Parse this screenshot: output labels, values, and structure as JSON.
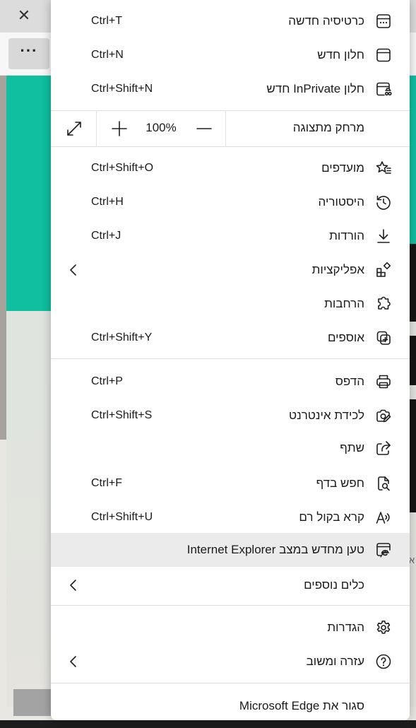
{
  "browser": {
    "close_glyph": "✕",
    "more_glyph": "···"
  },
  "background_page": {
    "accent_color": "#0fbf9f",
    "side_text": "א"
  },
  "menu": {
    "items": [
      {
        "label": "כרטיסיה חדשה",
        "shortcut": "Ctrl+T",
        "icon": "new-tab-icon"
      },
      {
        "label": "חלון חדש",
        "shortcut": "Ctrl+N",
        "icon": "new-window-icon"
      },
      {
        "label": "חלון InPrivate חדש",
        "shortcut": "Ctrl+Shift+N",
        "icon": "inprivate-icon"
      },
      {
        "label": "מועדפים",
        "shortcut": "Ctrl+Shift+O",
        "icon": "favorites-icon"
      },
      {
        "label": "היסטוריה",
        "shortcut": "Ctrl+H",
        "icon": "history-icon"
      },
      {
        "label": "הורדות",
        "shortcut": "Ctrl+J",
        "icon": "downloads-icon"
      },
      {
        "label": "אפליקציות",
        "shortcut": "",
        "icon": "apps-icon",
        "submenu": true
      },
      {
        "label": "הרחבות",
        "shortcut": "",
        "icon": "extensions-icon"
      },
      {
        "label": "אוספים",
        "shortcut": "Ctrl+Shift+Y",
        "icon": "collections-icon"
      },
      {
        "label": "הדפס",
        "shortcut": "Ctrl+P",
        "icon": "print-icon"
      },
      {
        "label": "לכידת אינטרנט",
        "shortcut": "Ctrl+Shift+S",
        "icon": "web-capture-icon"
      },
      {
        "label": "שתף",
        "shortcut": "",
        "icon": "share-icon"
      },
      {
        "label": "חפש בדף",
        "shortcut": "Ctrl+F",
        "icon": "find-icon"
      },
      {
        "label": "קרא בקול רם",
        "shortcut": "Ctrl+Shift+U",
        "icon": "read-aloud-icon"
      },
      {
        "label": "טען מחדש במצב Internet Explorer",
        "shortcut": "",
        "icon": "ie-mode-icon",
        "highlighted": true
      },
      {
        "label": "כלים נוספים",
        "shortcut": "",
        "icon": "",
        "submenu": true
      },
      {
        "label": "הגדרות",
        "shortcut": "",
        "icon": "settings-icon"
      },
      {
        "label": "עזרה ומשוב",
        "shortcut": "",
        "icon": "help-icon",
        "submenu": true
      },
      {
        "label": "סגור את Microsoft Edge",
        "shortcut": "",
        "icon": ""
      }
    ],
    "zoom": {
      "label": "מרחק מתצוגה",
      "level": "100%"
    },
    "highlight_color": "#ebebeb"
  }
}
